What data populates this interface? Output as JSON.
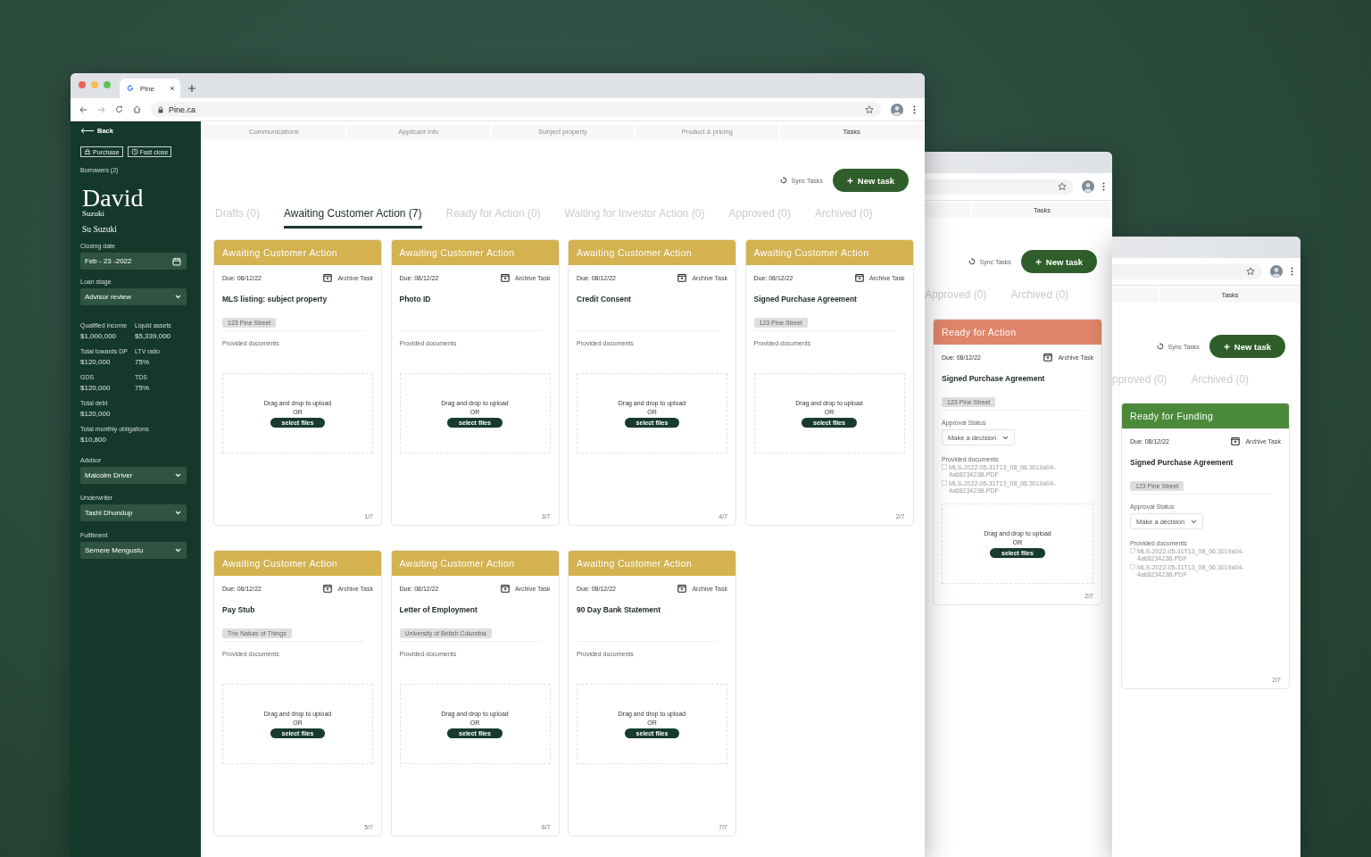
{
  "main_window": {
    "browser": {
      "tab_title": "Pine",
      "url": "Pine.ca"
    },
    "sidebar": {
      "back": "Back",
      "chips": [
        {
          "kind": "purchase",
          "label": "Purchase"
        },
        {
          "kind": "clock",
          "label": "Fast close"
        }
      ],
      "borrowers": "Borrowers (2)",
      "first_name": "David",
      "last_name": "Suzuki",
      "co_borrower": "Su Suzuki",
      "fields_top": [
        {
          "kind": "date",
          "label": "Closing date",
          "value": "Feb - 23 -2022"
        },
        {
          "kind": "select",
          "label": "Loan stage",
          "value": "Advisor review"
        }
      ],
      "stats_rows": [
        [
          {
            "label": "Qualified income",
            "value": "$1,000,000"
          },
          {
            "label": "Liquid assets",
            "value": "$5,339,000"
          }
        ],
        [
          {
            "label": "Total towards DP",
            "value": "$120,000"
          },
          {
            "label": "LTV ratio",
            "value": "75%"
          }
        ],
        [
          {
            "label": "GDS",
            "value": "$120,000"
          },
          {
            "label": "TDS",
            "value": "75%"
          }
        ],
        [
          {
            "label": "Total debt",
            "value": "$120,000"
          }
        ],
        [
          {
            "label": "Total monthly obligations",
            "value": "$10,800"
          }
        ]
      ],
      "fields_bottom": [
        {
          "kind": "select",
          "label": "Advisor",
          "value": "Malcolm Driver"
        },
        {
          "kind": "select",
          "label": "Underwriter",
          "value": "Tashi Dhondup"
        },
        {
          "kind": "select",
          "label": "Fulfilment",
          "value": "Semere Mengustu"
        }
      ]
    },
    "nav_tabs": [
      {
        "label": "Communications",
        "selected": false
      },
      {
        "label": "Applicant info",
        "selected": false
      },
      {
        "label": "Subject property",
        "selected": false
      },
      {
        "label": "Product & pricing",
        "selected": false
      },
      {
        "label": "Tasks",
        "selected": true
      }
    ],
    "sync": "Sync Tasks",
    "new_task": "New task",
    "status_tabs": [
      {
        "label": "Drafts (0)",
        "selected": false
      },
      {
        "label": "Awaiting Customer Action (7)",
        "selected": true
      },
      {
        "label": "Ready for Action (0)",
        "selected": false
      },
      {
        "label": "Waiting for Investor Action (0)",
        "selected": false
      },
      {
        "label": "Approved (0)",
        "selected": false
      },
      {
        "label": "Archived (0)",
        "selected": false
      }
    ],
    "cards": [
      {
        "status": "Awaiting Customer Action",
        "color": "#d3b24f",
        "due": "Due: 08/12/22",
        "archive": "Archive Task",
        "title": "MLS listing: subject property",
        "tag": "123 Pine Street",
        "docs_label": "Provided documents",
        "upload": {
          "hint": "Drag and drop to upload",
          "or": "OR",
          "button": "select files"
        },
        "count": "1/7"
      },
      {
        "status": "Awaiting Customer Action",
        "color": "#d3b24f",
        "due": "Due: 08/12/22",
        "archive": "Archive Task",
        "title": "Photo ID",
        "docs_label": "Provided documents",
        "upload": {
          "hint": "Drag and drop to upload",
          "or": "OR",
          "button": "select files"
        },
        "count": "3/7"
      },
      {
        "status": "Awaiting Customer Action",
        "color": "#d3b24f",
        "due": "Due: 08/12/22",
        "archive": "Archive Task",
        "title": "Credit Consent",
        "docs_label": "Provided documents",
        "upload": {
          "hint": "Drag and drop to upload",
          "or": "OR",
          "button": "select files"
        },
        "count": "4/7"
      },
      {
        "status": "Awaiting Customer Action",
        "color": "#d3b24f",
        "due": "Due: 08/12/22",
        "archive": "Archive Task",
        "title": "Signed Purchase Agreement",
        "tag": "123 Pine Street",
        "docs_label": "Provided documents",
        "upload": {
          "hint": "Drag and drop to upload",
          "or": "OR",
          "button": "select files"
        },
        "count": "2/7"
      },
      {
        "status": "Awaiting Customer Action",
        "color": "#d3b24f",
        "due": "Due: 08/12/22",
        "archive": "Archive Task",
        "title": "Pay Stub",
        "tag": "The Nature of Things",
        "docs_label": "Provided documents",
        "upload": {
          "hint": "Drag and drop to upload",
          "or": "OR",
          "button": "select files"
        },
        "count": "5/7"
      },
      {
        "status": "Awaiting Customer Action",
        "color": "#d3b24f",
        "due": "Due: 08/12/22",
        "archive": "Archive Task",
        "title": "Letter of Employment",
        "tag": "University of British Columbia",
        "docs_label": "Provided documents",
        "upload": {
          "hint": "Drag and drop to upload",
          "or": "OR",
          "button": "select files"
        },
        "count": "6/7"
      },
      {
        "status": "Awaiting Customer Action",
        "color": "#d3b24f",
        "due": "Due: 08/12/22",
        "archive": "Archive Task",
        "title": "90 Day Bank Statement",
        "docs_label": "Provided documents",
        "upload": {
          "hint": "Drag and drop to upload",
          "or": "OR",
          "button": "select files"
        },
        "count": "7/7"
      }
    ]
  },
  "back_windows": [
    {
      "tab": "Tasks",
      "sync": "Sync Tasks",
      "new_task": "New task",
      "status_tabs": [
        {
          "label": "Approved (0)",
          "selected": false
        },
        {
          "label": "Archived (0)",
          "selected": false
        }
      ],
      "card": {
        "status": "Ready for Action",
        "color": "#e0856a",
        "due": "Due: 08/12/22",
        "archive": "Archive Task",
        "title": "Signed Purchase Agreement",
        "tag": "123 Pine Street",
        "approval": {
          "label": "Approval Status",
          "value": "Make a decision"
        },
        "docs_label": "Provided documents",
        "documents": [
          "MLS-2022-05-31T13_08_06.3019a04-4a6823423B.PDF",
          "MLS-2022-05-31T13_08_06.3019a04-4a6823423B.PDF"
        ],
        "upload": {
          "hint": "Drag and drop to upload",
          "or": "OR",
          "button": "select files"
        },
        "count": "2/7"
      }
    },
    {
      "tab": "Tasks",
      "sync": "Sync Tasks",
      "new_task": "New task",
      "status_tabs": [
        {
          "label": "pproved (0)",
          "selected": false
        },
        {
          "label": "Archived (0)",
          "selected": false
        }
      ],
      "card": {
        "status": "Ready for Funding",
        "color": "#4b8a3b",
        "due": "Due: 08/12/22",
        "archive": "Archive Task",
        "title": "Signed Purchase Agreement",
        "tag": "123 Pine Street",
        "approval": {
          "label": "Approval Status",
          "value": "Make a decision"
        },
        "docs_label": "Provided documents",
        "documents": [
          "MLS-2022-05-31T13_08_06.3019a04-4a6823423B.PDF",
          "MLS-2022-05-31T13_08_06.3019a04-4a6823423B.PDF"
        ],
        "count": "2/7"
      }
    }
  ]
}
